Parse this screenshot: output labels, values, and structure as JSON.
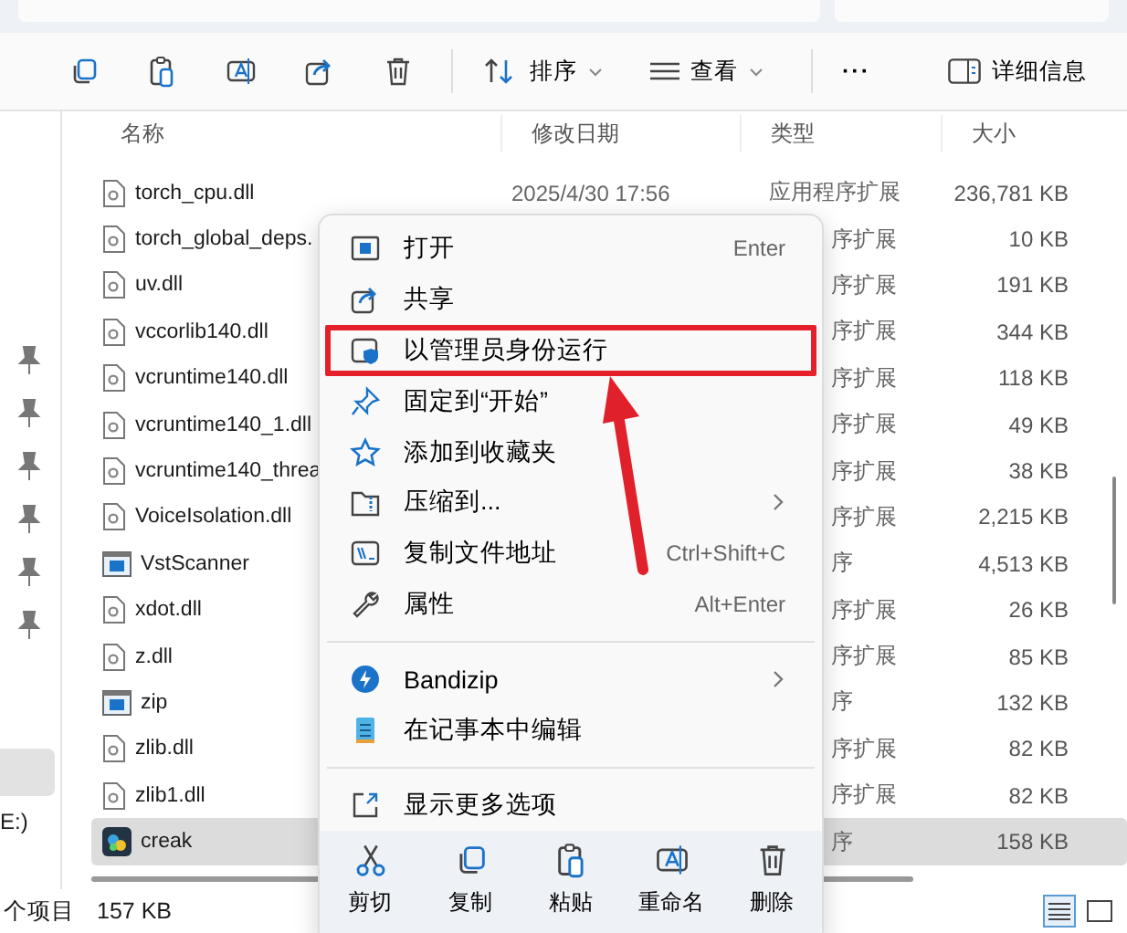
{
  "toolbar": {
    "sort": "排序",
    "view": "查看",
    "more": "···",
    "details": "详细信息"
  },
  "columns": [
    "名称",
    "修改日期",
    "类型",
    "大小"
  ],
  "rows": [
    {
      "name": "torch_cpu.dll",
      "kind": "dll",
      "date": "2025/4/30 17:56",
      "type": "应用程序扩展",
      "size": "236,781 KB",
      "selected": false
    },
    {
      "name": "torch_global_deps.",
      "kind": "dll",
      "type": "序扩展",
      "size": "10 KB",
      "selected": false
    },
    {
      "name": "uv.dll",
      "kind": "dll",
      "type": "序扩展",
      "size": "191 KB",
      "selected": false
    },
    {
      "name": "vccorlib140.dll",
      "kind": "dll",
      "type": "序扩展",
      "size": "344 KB",
      "selected": false
    },
    {
      "name": "vcruntime140.dll",
      "kind": "dll",
      "type": "序扩展",
      "size": "118 KB",
      "selected": false
    },
    {
      "name": "vcruntime140_1.dll",
      "kind": "dll",
      "type": "序扩展",
      "size": "49 KB",
      "selected": false
    },
    {
      "name": "vcruntime140_threa",
      "kind": "dll",
      "type": "序扩展",
      "size": "38 KB",
      "selected": false
    },
    {
      "name": "VoiceIsolation.dll",
      "kind": "dll",
      "type": "序扩展",
      "size": "2,215 KB",
      "selected": false
    },
    {
      "name": "VstScanner",
      "kind": "exe",
      "type": "序",
      "size": "4,513 KB",
      "selected": false
    },
    {
      "name": "xdot.dll",
      "kind": "dll",
      "type": "序扩展",
      "size": "26 KB",
      "selected": false
    },
    {
      "name": "z.dll",
      "kind": "dll",
      "type": "序扩展",
      "size": "85 KB",
      "selected": false
    },
    {
      "name": "zip",
      "kind": "exe",
      "type": "序",
      "size": "132 KB",
      "selected": false
    },
    {
      "name": "zlib.dll",
      "kind": "dll",
      "type": "序扩展",
      "size": "82 KB",
      "selected": false
    },
    {
      "name": "zlib1.dll",
      "kind": "dll",
      "type": "序扩展",
      "size": "82 KB",
      "selected": false
    },
    {
      "name": "creak",
      "kind": "app",
      "type": "序",
      "size": "158 KB",
      "selected": true
    }
  ],
  "nav": {
    "drive": "E:)"
  },
  "status": {
    "count": "个项目",
    "size": "157 KB"
  },
  "menu": {
    "items": [
      {
        "kind": "open",
        "label": "打开",
        "shortcut": "Enter",
        "highlighted": false
      },
      {
        "kind": "share",
        "label": "共享",
        "highlighted": false
      },
      {
        "kind": "admin",
        "label": "以管理员身份运行",
        "highlighted": true
      },
      {
        "kind": "pin",
        "label": "固定到“开始”",
        "highlighted": false
      },
      {
        "kind": "star",
        "label": "添加到收藏夹",
        "highlighted": false
      },
      {
        "kind": "zip",
        "label": "压缩到...",
        "submenu": true,
        "highlighted": false
      },
      {
        "kind": "path",
        "label": "复制文件地址",
        "shortcut": "Ctrl+Shift+C",
        "highlighted": false
      },
      {
        "kind": "props",
        "label": "属性",
        "shortcut": "Alt+Enter",
        "highlighted": false
      },
      {
        "kind": "divider"
      },
      {
        "kind": "bandizip",
        "label": "Bandizip",
        "submenu": true,
        "highlighted": false
      },
      {
        "kind": "notepad",
        "label": "在记事本中编辑",
        "highlighted": false
      },
      {
        "kind": "divider"
      },
      {
        "kind": "more",
        "label": "显示更多选项",
        "highlighted": false
      }
    ],
    "actions": [
      {
        "kind": "cut",
        "label": "剪切"
      },
      {
        "kind": "copy",
        "label": "复制"
      },
      {
        "kind": "paste",
        "label": "粘贴"
      },
      {
        "kind": "rename",
        "label": "重命名"
      },
      {
        "kind": "delete",
        "label": "删除"
      }
    ]
  }
}
